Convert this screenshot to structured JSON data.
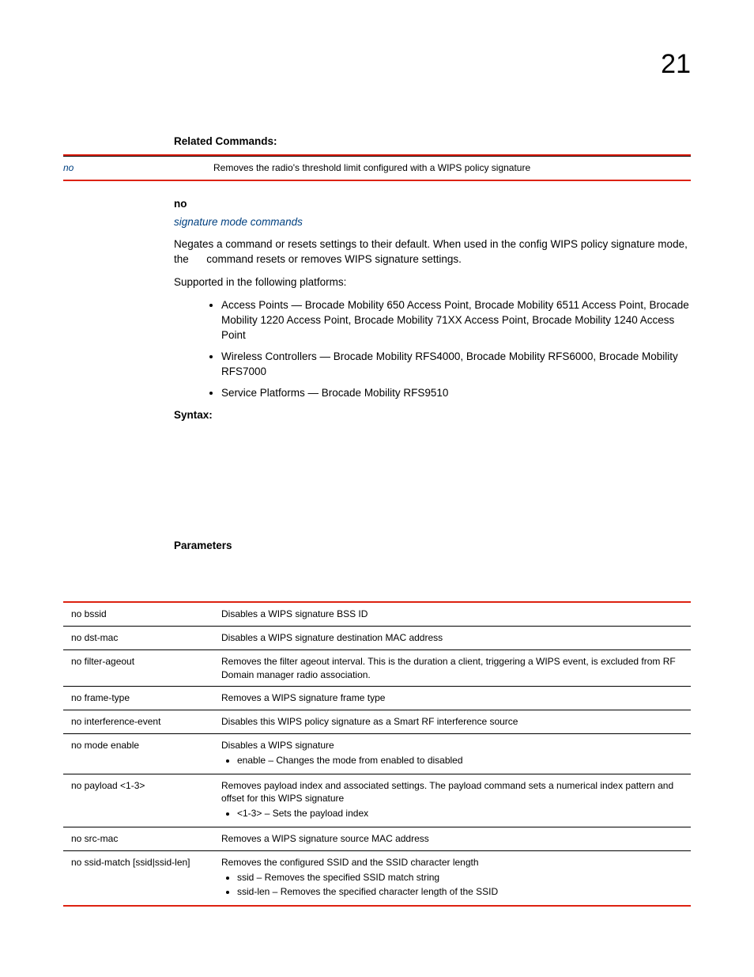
{
  "chapter_number": "21",
  "related_commands": {
    "heading": "Related Commands:",
    "rows": [
      {
        "term": "no",
        "desc": "Removes the radio's threshold limit configured with a WIPS policy signature"
      }
    ]
  },
  "no_section": {
    "heading": "no",
    "link": "signature mode commands",
    "para1": "Negates a command or resets settings to their default. When used in the config WIPS policy signature mode, the      command resets or removes WIPS signature settings.",
    "para2": "Supported in the following platforms:",
    "bullets": [
      "Access Points — Brocade Mobility 650 Access Point, Brocade Mobility 6511 Access Point, Brocade Mobility 1220 Access Point, Brocade Mobility 71XX Access Point, Brocade Mobility 1240 Access Point",
      "Wireless Controllers — Brocade Mobility RFS4000, Brocade Mobility RFS6000, Brocade Mobility RFS7000",
      "Service Platforms — Brocade Mobility RFS9510"
    ]
  },
  "syntax_heading": "Syntax:",
  "parameters": {
    "heading": "Parameters",
    "rows": [
      {
        "term": "no bssid",
        "desc": "Disables a WIPS signature BSS ID",
        "bullets": []
      },
      {
        "term": "no dst-mac",
        "desc": "Disables a WIPS signature destination MAC address",
        "bullets": []
      },
      {
        "term": "no filter-ageout",
        "desc": "Removes the filter ageout interval. This is the duration a client, triggering a WIPS event, is excluded from RF Domain manager radio association.",
        "bullets": []
      },
      {
        "term": "no frame-type",
        "desc": "Removes a WIPS signature frame type",
        "bullets": []
      },
      {
        "term": "no interference-event",
        "desc": "Disables this WIPS policy signature as a Smart RF interference source",
        "bullets": []
      },
      {
        "term": "no mode enable",
        "desc": "Disables a WIPS signature",
        "bullets": [
          "enable – Changes the mode from enabled to disabled"
        ]
      },
      {
        "term": "no payload <1-3>",
        "desc": "Removes payload index and associated settings. The payload command sets a numerical index pattern and offset for this WIPS signature",
        "bullets": [
          "<1-3> – Sets the payload index"
        ]
      },
      {
        "term": "no src-mac",
        "desc": "Removes a WIPS signature source MAC address",
        "bullets": []
      },
      {
        "term": "no ssid-match [ssid|ssid-len]",
        "desc": "Removes the configured SSID and the SSID character length",
        "bullets": [
          "ssid – Removes the specified SSID match string",
          "ssid-len – Removes the specified character length of the SSID"
        ]
      }
    ]
  }
}
